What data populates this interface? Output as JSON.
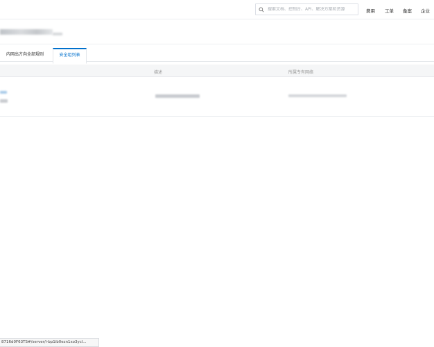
{
  "header": {
    "search_placeholder": "搜索文档、控制台、API、解决方案和资源",
    "nav": [
      "费用",
      "工单",
      "备案",
      "企业"
    ]
  },
  "tabs": [
    {
      "label": "内网出方向全部规则",
      "active": false
    },
    {
      "label": "安全组列表",
      "active": true
    }
  ],
  "table": {
    "columns": [
      "描述",
      "所属专有网络"
    ]
  },
  "statusbar": {
    "url": "8716d0F63TS#/server/i-bp1ib0ezn1xo3ycl..."
  },
  "colors": {
    "accent": "#0070cc",
    "link_blur": "#a9cbe9"
  }
}
